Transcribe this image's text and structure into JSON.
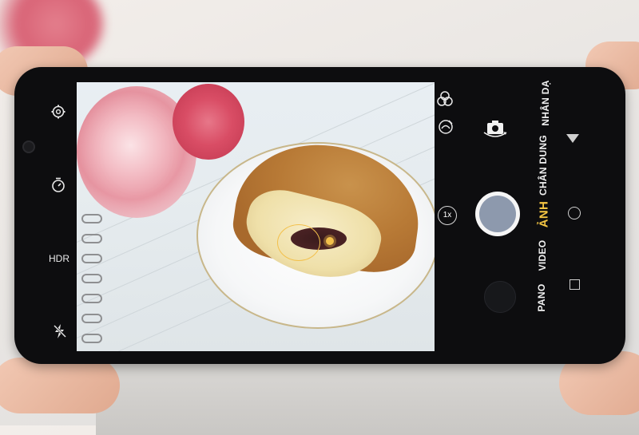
{
  "camera": {
    "left_controls": {
      "hdr_label": "HDR",
      "icons": [
        "gear-icon",
        "timer-icon",
        "flash-off-icon"
      ]
    },
    "right_controls": {
      "icons": [
        "filter-icon",
        "beauty-icon",
        "switch-camera-icon"
      ],
      "zoom_label": "1x"
    },
    "modes": [
      {
        "label": "NHÂN DẠ",
        "active": false
      },
      {
        "label": "CHÂN DUNG",
        "active": false
      },
      {
        "label": "ẢNH",
        "active": true
      },
      {
        "label": "VIDEO",
        "active": false
      },
      {
        "label": "PANO",
        "active": false
      }
    ],
    "nav_icons": [
      "back-triangle-icon",
      "home-circle-icon",
      "recents-square-icon"
    ],
    "accent_color": "#f4c543",
    "shutter_color": "#8d99ad"
  }
}
